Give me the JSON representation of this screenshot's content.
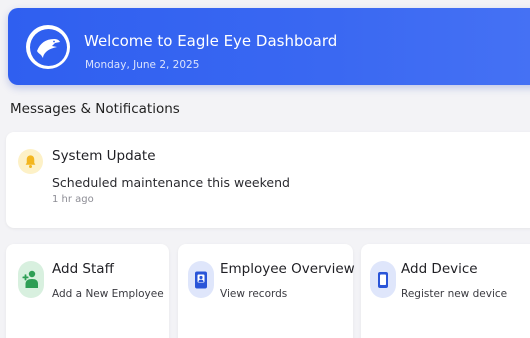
{
  "header": {
    "title": "Welcome to Eagle Eye Dashboard",
    "date": "Monday, June 2, 2025",
    "logo_icon": "eagle-icon"
  },
  "notifications": {
    "section_title": "Messages & Notifications",
    "items": [
      {
        "icon": "bell-icon",
        "title": "System Update",
        "body": "Scheduled maintenance this weekend",
        "time": "1 hr ago"
      }
    ]
  },
  "actions": [
    {
      "icon": "add-person-icon",
      "title": "Add Staff",
      "subtitle": "Add a New Employee"
    },
    {
      "icon": "id-badge-icon",
      "title": "Employee Overview",
      "subtitle": "View records"
    },
    {
      "icon": "device-icon",
      "title": "Add Device",
      "subtitle": "Register new device"
    }
  ],
  "colors": {
    "accent": "#2f5ff0",
    "bell_bg": "#fdf1c7",
    "bell": "#f3b61f",
    "staff_icon": "#2e9e55",
    "blue_icon": "#2a55d8"
  }
}
